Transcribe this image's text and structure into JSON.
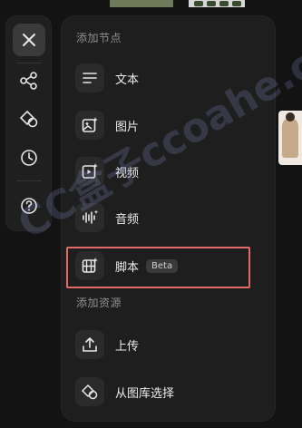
{
  "rail": {
    "close_icon": "close-icon",
    "items": [
      {
        "name": "nodes-icon"
      },
      {
        "name": "shapes-icon"
      },
      {
        "name": "history-icon"
      },
      {
        "name": "help-icon"
      }
    ]
  },
  "panel": {
    "section_nodes": "添加节点",
    "nodes": [
      {
        "label": "文本",
        "icon": "text-icon"
      },
      {
        "label": "图片",
        "icon": "image-icon"
      },
      {
        "label": "视频",
        "icon": "video-icon"
      },
      {
        "label": "音频",
        "icon": "audio-icon"
      },
      {
        "label": "脚本",
        "icon": "script-icon",
        "badge": "Beta"
      }
    ],
    "section_assets": "添加资源",
    "assets": [
      {
        "label": "上传",
        "icon": "upload-icon"
      },
      {
        "label": "从图库选择",
        "icon": "gallery-icon"
      }
    ]
  },
  "watermark": "CC盒子ccoahe.com",
  "colors": {
    "background": "#131313",
    "panel": "#1e1e1e",
    "highlight": "#e26a66"
  }
}
